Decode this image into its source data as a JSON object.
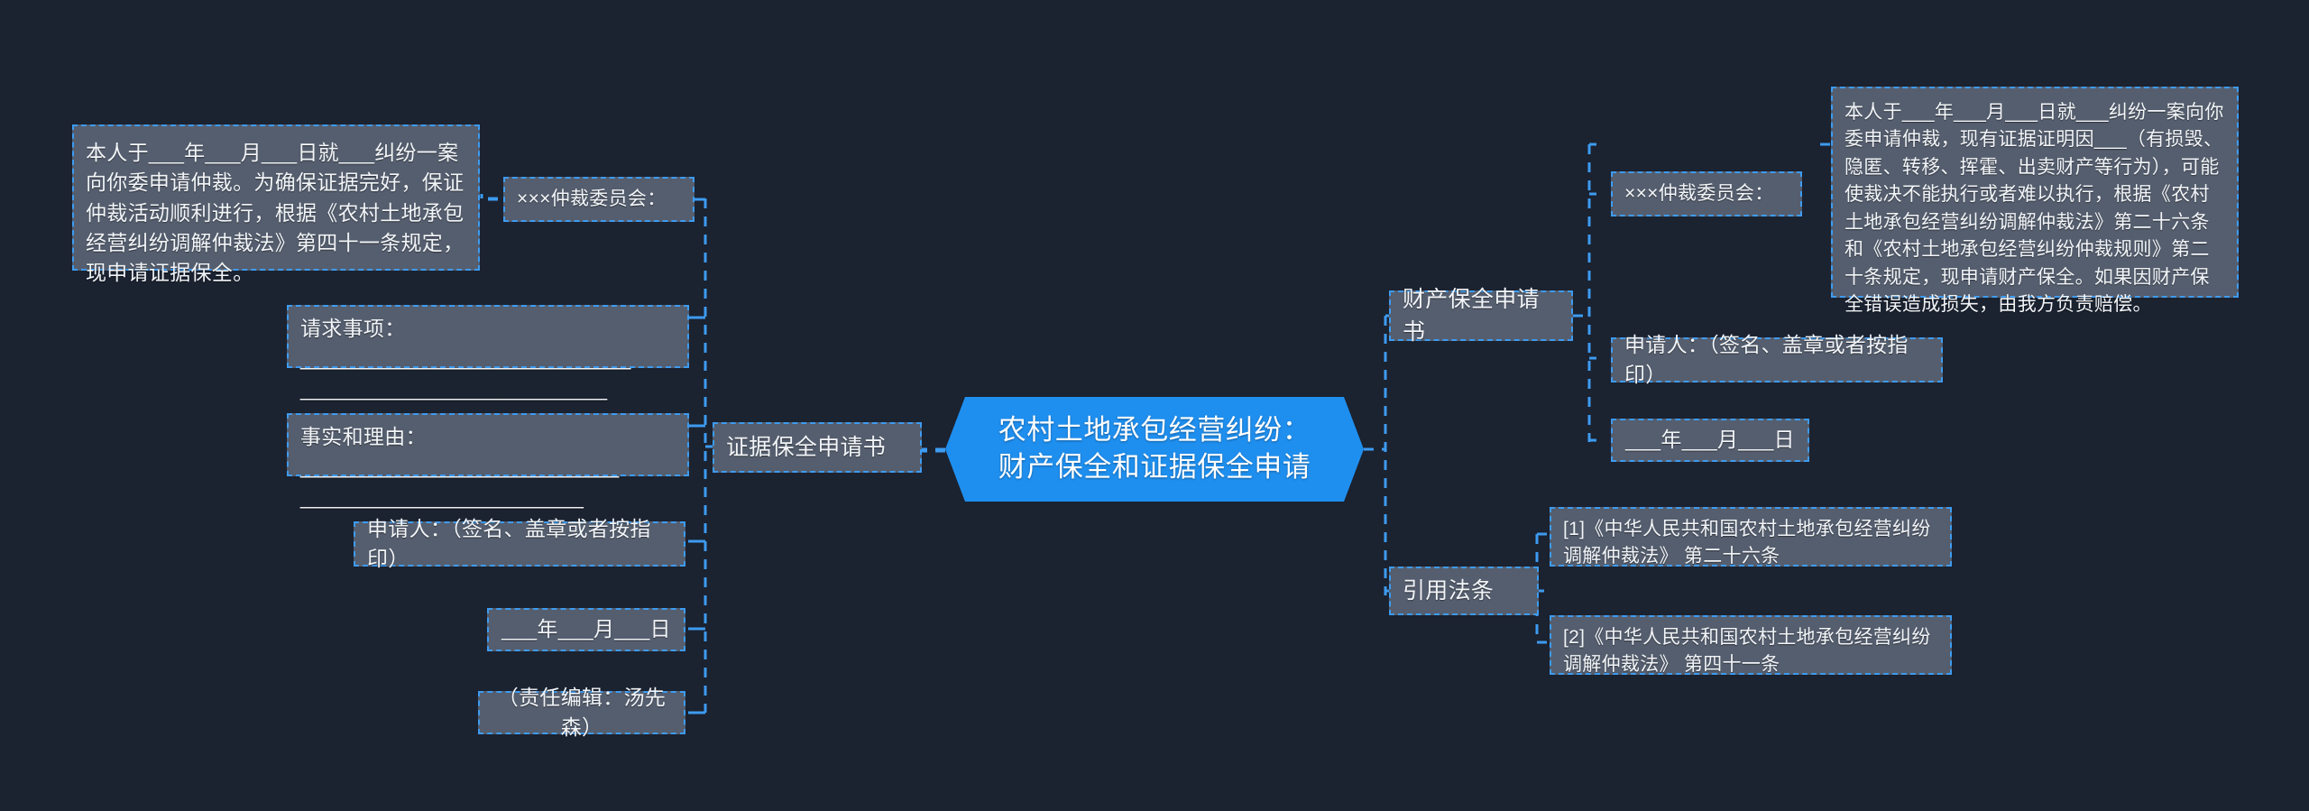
{
  "theme": {
    "background": "#1b2230",
    "node_fill": "#555e6e",
    "node_border": "#3d9bf0",
    "root_fill": "#1f8fef",
    "root_text": "#ffffff",
    "node_text": "#f2f5f8",
    "link_color": "#3d9bf0"
  },
  "root": {
    "title": "农村土地承包经营纠纷：\n财产保全和证据保全申请"
  },
  "branches": {
    "evidence": {
      "label": "证据保全申请书",
      "children": [
        {
          "id": "evi-committee",
          "label": "×××仲裁委员会："
        },
        {
          "id": "evi-body",
          "label": "本人于___年___月___日就___纠纷一案向你委申请仲裁。为确保证据完好，保证仲裁活动顺利进行，根据《农村土地承包经营纠纷调解仲裁法》第四十一条规定，现申请证据保全。"
        },
        {
          "id": "evi-request",
          "label": "请求事项：____________________________\n__________________________"
        },
        {
          "id": "evi-facts",
          "label": "事实和理由：___________________________\n________________________"
        },
        {
          "id": "evi-applicant",
          "label": "申请人：（签名、盖章或者按指印）"
        },
        {
          "id": "evi-date",
          "label": "___年___月___日"
        },
        {
          "id": "evi-editor",
          "label": "（责任编辑：汤先森）"
        }
      ]
    },
    "property": {
      "label": "财产保全申请书",
      "children": [
        {
          "id": "pro-committee",
          "label": "×××仲裁委员会："
        },
        {
          "id": "pro-body",
          "label": "本人于___年___月___日就___纠纷一案向你委申请仲裁，现有证据证明因___（有损毁、隐匿、转移、挥霍、出卖财产等行为），可能使裁决不能执行或者难以执行，根据《农村土地承包经营纠纷调解仲裁法》第二十六条和《农村土地承包经营纠纷仲裁规则》第二十条规定，现申请财产保全。如果因财产保全错误造成损失，由我方负责赔偿。"
        },
        {
          "id": "pro-applicant",
          "label": "申请人：（签名、盖章或者按指印）"
        },
        {
          "id": "pro-date",
          "label": "___年___月___日"
        }
      ]
    },
    "citations": {
      "label": "引用法条",
      "children": [
        {
          "id": "cite-1",
          "label": "[1]《中华人民共和国农村土地承包经营纠纷\n调解仲裁法》 第二十六条"
        },
        {
          "id": "cite-2",
          "label": "[2]《中华人民共和国农村土地承包经营纠纷\n调解仲裁法》 第四十一条"
        }
      ]
    }
  }
}
